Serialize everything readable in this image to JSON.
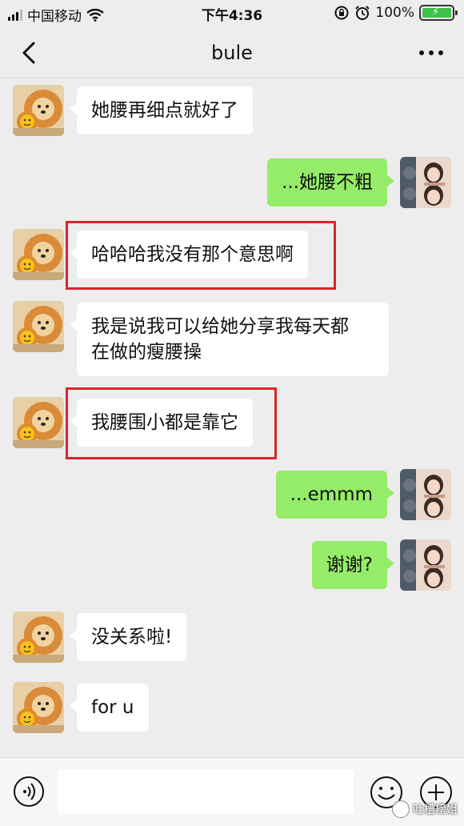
{
  "status_bar": {
    "carrier": "中国移动",
    "time": "下午4:36",
    "battery": "100%",
    "battery_level": 1.0
  },
  "nav": {
    "title": "bule",
    "back_icon": "chevron-left-icon",
    "more_icon": "more-dots-icon"
  },
  "messages": [
    {
      "side": "in",
      "text": "她腰再细点就好了"
    },
    {
      "side": "out",
      "text": "...她腰不粗"
    },
    {
      "side": "in",
      "text": "哈哈哈我没有那个意思啊",
      "highlighted": true
    },
    {
      "side": "in",
      "text_lines": [
        "我是说我可以给她分享我每天都",
        "在做的瘦腰操"
      ]
    },
    {
      "side": "in",
      "text": "我腰围小都是靠它",
      "highlighted": true
    },
    {
      "side": "out",
      "text": "...emmm"
    },
    {
      "side": "out",
      "text": "谢谢?"
    },
    {
      "side": "in",
      "text": "没关系啦!"
    },
    {
      "side": "in",
      "text": "for u"
    }
  ],
  "input_bar": {
    "voice_icon": "voice-icon",
    "emoji_icon": "emoji-icon",
    "plus_icon": "plus-icon",
    "value": ""
  },
  "watermark": {
    "text": "吐槽榜姐"
  },
  "colors": {
    "background": "#ededed",
    "incoming_bubble": "#ffffff",
    "outgoing_bubble": "#95ec69",
    "highlight_border": "#d7262b",
    "battery": "#3cc24a"
  }
}
